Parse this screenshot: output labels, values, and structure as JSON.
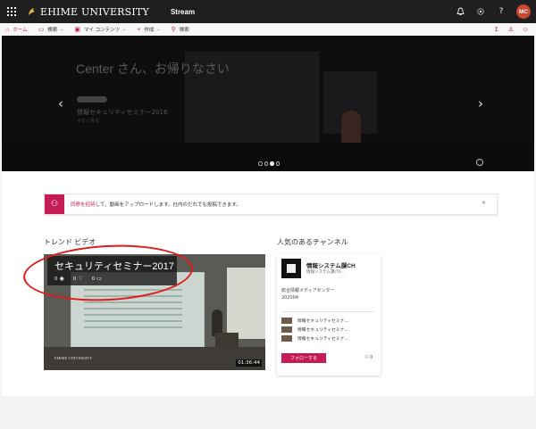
{
  "header": {
    "logo_text": "EHIME UNIVERSITY",
    "app_name": "Stream",
    "user_initials": "MC",
    "icons": [
      "bell-icon",
      "gear-icon",
      "help-icon"
    ]
  },
  "nav": {
    "home": "ホーム",
    "browse": "検索",
    "my_content": "マイ コンテンツ",
    "create": "作成",
    "search": "検索"
  },
  "hero": {
    "greeting": "Center さん、お帰りなさい",
    "video_title": "情報セキュリティセミナー2016",
    "video_sub": "今すぐ見る",
    "slide_count": 4,
    "active_slide": 3
  },
  "invite": {
    "link_text": "同僚を招待",
    "text": "して、動画をアップロードします。社内のだれでも投稿できます。",
    "close": "×"
  },
  "trending": {
    "heading": "トレンド ビデオ",
    "video": {
      "title": "セキュリティセミナー2017",
      "views": "0",
      "likes": "0",
      "comments": "0",
      "logo": "EHIME UNIVERSITY",
      "duration": "01:36:44"
    }
  },
  "channels": {
    "heading": "人気のあるチャンネル",
    "channel": {
      "name": "情報システム課CH",
      "owner": "情報システム課(T0...",
      "desc_line1": "総合情報メディアセンター",
      "desc_line2": "202004",
      "videos": [
        "情報セキュリティセミナ...",
        "情報セキュリティセミナ...",
        "情報セキュリティセミナ..."
      ],
      "follow_label": "フォローする",
      "followers": "0"
    }
  },
  "colors": {
    "accent": "#c31c57",
    "annotation": "#e01b1b",
    "topbar": "#1f1f1f"
  }
}
